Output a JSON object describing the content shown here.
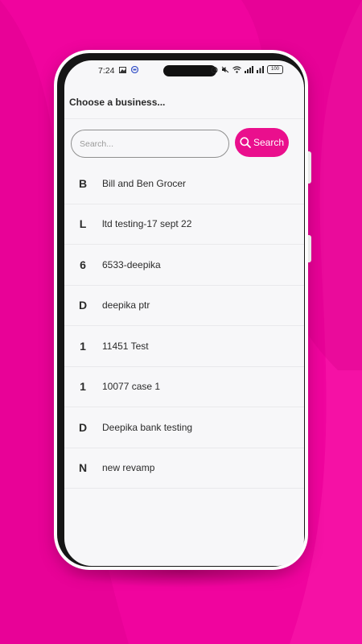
{
  "status_bar": {
    "time": "7:24",
    "battery": "100",
    "icons": [
      "image-icon",
      "app-icon",
      "alarm-icon",
      "mute-icon",
      "wifi-icon",
      "signal-icon",
      "battery-icon"
    ]
  },
  "header": {
    "title": "Choose a business..."
  },
  "search": {
    "placeholder": "Search...",
    "value": "",
    "button_label": "Search"
  },
  "businesses": [
    {
      "initial": "B",
      "name": "Bill and Ben Grocer"
    },
    {
      "initial": "L",
      "name": "ltd testing-17 sept 22"
    },
    {
      "initial": "6",
      "name": "6533-deepika"
    },
    {
      "initial": "D",
      "name": "deepika ptr"
    },
    {
      "initial": "1",
      "name": "11451 Test"
    },
    {
      "initial": "1",
      "name": "10077 case 1"
    },
    {
      "initial": "D",
      "name": "Deepika bank testing"
    },
    {
      "initial": "N",
      "name": "new revamp"
    }
  ],
  "colors": {
    "background": "#f0049e",
    "accent": "#ea0f8d",
    "screen": "#f7f7f9"
  }
}
